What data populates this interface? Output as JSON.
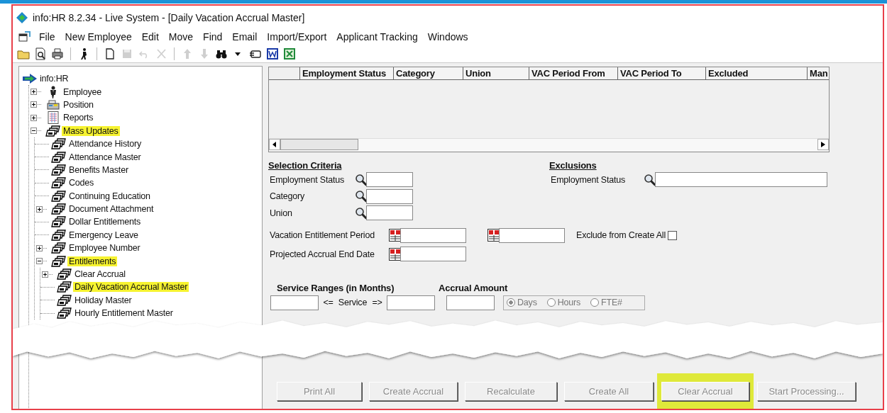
{
  "window": {
    "title": "info:HR 8.2.34 -  Live System  - [Daily Vacation Accrual Master]"
  },
  "menu": [
    "File",
    "New Employee",
    "Edit",
    "Move",
    "Find",
    "Email",
    "Import/Export",
    "Applicant Tracking",
    "Windows"
  ],
  "toolbar": [
    {
      "kind": "folder",
      "disabled": false
    },
    {
      "kind": "preview",
      "disabled": false
    },
    {
      "kind": "print",
      "disabled": false
    },
    {
      "kind": "separator"
    },
    {
      "kind": "runner",
      "disabled": false
    },
    {
      "kind": "separator"
    },
    {
      "kind": "new",
      "disabled": false
    },
    {
      "kind": "save",
      "disabled": true
    },
    {
      "kind": "undo",
      "disabled": true
    },
    {
      "kind": "delete",
      "disabled": true
    },
    {
      "kind": "separator"
    },
    {
      "kind": "up",
      "disabled": true
    },
    {
      "kind": "down",
      "disabled": true
    },
    {
      "kind": "binoculars",
      "disabled": false
    },
    {
      "kind": "caret",
      "disabled": false
    },
    {
      "kind": "card",
      "disabled": false
    },
    {
      "kind": "word",
      "disabled": false
    },
    {
      "kind": "excel",
      "disabled": false
    }
  ],
  "tree": {
    "label": "info:HR",
    "kind": "root",
    "highlighted": false,
    "children": [
      {
        "label": "Employee",
        "kind": "person",
        "expanded": false,
        "highlighted": false
      },
      {
        "label": "Position",
        "kind": "desk",
        "expanded": false,
        "highlighted": false
      },
      {
        "label": "Reports",
        "kind": "report",
        "expanded": false,
        "highlighted": false
      },
      {
        "label": "Mass Updates",
        "kind": "stack",
        "expanded": true,
        "highlighted": true,
        "children": [
          {
            "label": "Attendance History",
            "kind": "stack",
            "highlighted": false
          },
          {
            "label": "Attendance Master",
            "kind": "stack",
            "highlighted": false
          },
          {
            "label": "Benefits Master",
            "kind": "stack",
            "highlighted": false
          },
          {
            "label": "Codes",
            "kind": "stack",
            "highlighted": false
          },
          {
            "label": "Continuing Education",
            "kind": "stack",
            "highlighted": false
          },
          {
            "label": "Document Attachment",
            "kind": "stack",
            "expanded": false,
            "highlighted": false
          },
          {
            "label": "Dollar Entitlements",
            "kind": "stack",
            "highlighted": false
          },
          {
            "label": "Emergency Leave",
            "kind": "stack",
            "highlighted": false
          },
          {
            "label": "Employee Number",
            "kind": "stack",
            "expanded": false,
            "highlighted": false
          },
          {
            "label": "Entitlements",
            "kind": "stack",
            "expanded": true,
            "highlighted": true,
            "children": [
              {
                "label": "Clear Accrual",
                "kind": "stack",
                "expanded": false,
                "highlighted": false
              },
              {
                "label": "Daily Vacation Accrual Master",
                "kind": "stack",
                "highlighted": true
              },
              {
                "label": "Holiday Master",
                "kind": "stack",
                "highlighted": false
              },
              {
                "label": "Hourly Entitlement Master",
                "kind": "stack",
                "highlighted": false
              }
            ]
          }
        ]
      }
    ]
  },
  "table": {
    "columns": [
      "Employment Status",
      "Category",
      "Union",
      "VAC Period From",
      "VAC Period To",
      "Excluded",
      "Man"
    ]
  },
  "selection_criteria": {
    "heading": "Selection Criteria",
    "fields": [
      {
        "label": "Employment Status"
      },
      {
        "label": "Category"
      },
      {
        "label": "Union"
      }
    ]
  },
  "exclusions": {
    "heading": "Exclusions",
    "fields": [
      {
        "label": "Employment Status"
      }
    ]
  },
  "vacation_period": {
    "label": "Vacation Entitlement Period"
  },
  "exclude_from_create_all": {
    "label": "Exclude from Create All",
    "checked": false
  },
  "projected_end": {
    "label": "Projected Accrual End Date"
  },
  "service": {
    "ranges_heading": "Service Ranges (in Months)",
    "amount_heading": "Accrual Amount",
    "rows": [
      {
        "between": "<= Service =>",
        "units": [
          {
            "label": "Days",
            "selected": true
          },
          {
            "label": "Hours",
            "selected": false
          },
          {
            "label": "FTE#",
            "selected": false
          }
        ]
      }
    ]
  },
  "buttons": [
    {
      "label": "Print All",
      "disabled": true,
      "highlighted": false
    },
    {
      "label": "Create Accrual",
      "disabled": true,
      "highlighted": false
    },
    {
      "label": "Recalculate",
      "disabled": true,
      "highlighted": false
    },
    {
      "label": "Create All",
      "disabled": true,
      "highlighted": false
    },
    {
      "label": "Clear Accrual",
      "disabled": true,
      "highlighted": true
    },
    {
      "label": "Start Processing...",
      "disabled": true,
      "highlighted": false
    }
  ]
}
